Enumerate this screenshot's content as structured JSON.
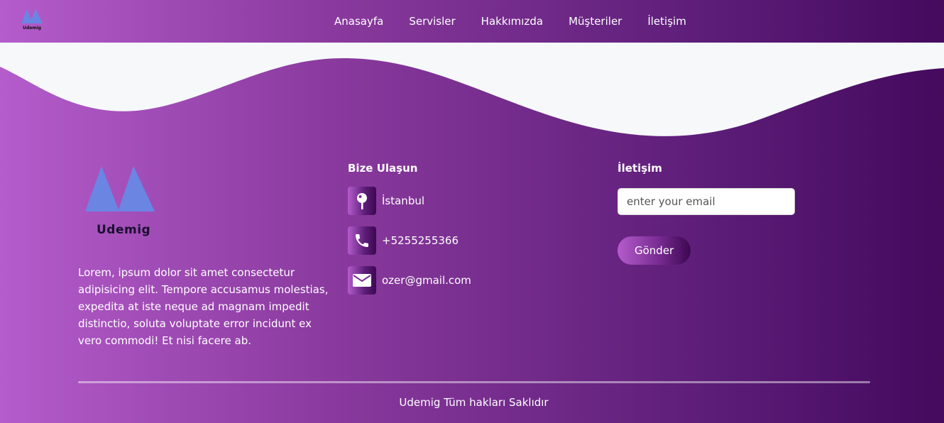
{
  "nav": {
    "logo_text": "Udemig",
    "links": [
      "Anasayfa",
      "Servisler",
      "Hakkımızda",
      "Müşteriler",
      "İletişim"
    ]
  },
  "brand": {
    "name": "Udemig",
    "description": "Lorem, ipsum dolor sit amet consectetur adipisicing elit. Tempore accusamus molestias, expedita at iste neque ad magnam impedit distinctio, soluta voluptate error incidunt ex vero commodi! Et nisi facere ab."
  },
  "contact": {
    "title": "Bize Ulaşun",
    "items": [
      {
        "icon": "map-pin-icon",
        "text": "İstanbul"
      },
      {
        "icon": "phone-icon",
        "text": "+5255255366"
      },
      {
        "icon": "envelope-icon",
        "text": "ozer@gmail.com"
      }
    ]
  },
  "subscribe": {
    "title": "İletişim",
    "placeholder": "enter your email",
    "button_label": "Gönder"
  },
  "footer": {
    "copyright": "Udemig Tüm hakları Saklıdır"
  },
  "colors": {
    "gradient_start": "#b45ccb",
    "gradient_end": "#45095e",
    "wave_fill": "#f6f8fa",
    "logo_blue": "#6b85e3"
  }
}
